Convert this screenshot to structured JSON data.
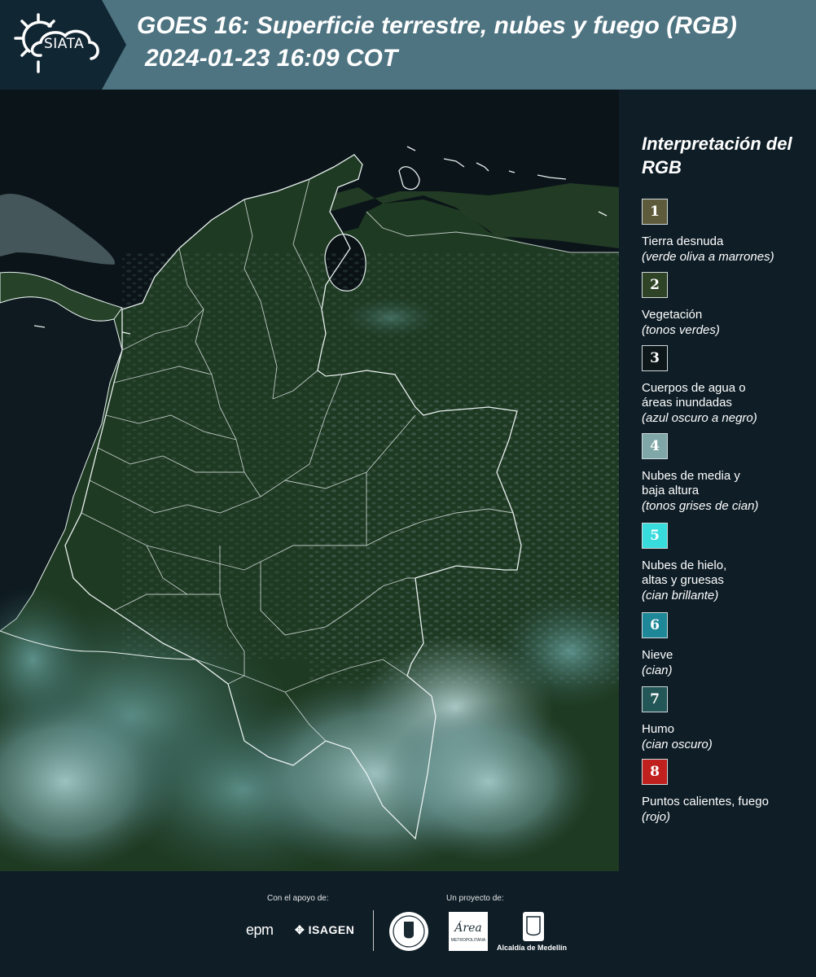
{
  "header": {
    "logo_text": "SIATA",
    "title": "GOES 16: Superficie terrestre, nubes y fuego (RGB)",
    "datetime": " 2024-01-23 16:09 COT"
  },
  "legend": {
    "title": "Interpretación del RGB",
    "items": [
      {
        "number": "1",
        "color": "#5e5b3d",
        "label": "Tierra desnuda",
        "description": "(verde oliva a marrones)"
      },
      {
        "number": "2",
        "color": "#2f4326",
        "label": "Vegetación",
        "description": "(tonos verdes)"
      },
      {
        "number": "3",
        "color": "#0d1618",
        "label": "Cuerpos de agua o\náreas inundadas",
        "description": "(azul oscuro a negro)"
      },
      {
        "number": "4",
        "color": "#7fa7a7",
        "label": "Nubes de media y\nbaja altura",
        "description": "(tonos grises de cian)"
      },
      {
        "number": "5",
        "color": "#38dcdc",
        "label": "Nubes de hielo,\naltas y gruesas",
        "description": "(cian brillante)"
      },
      {
        "number": "6",
        "color": "#1e8898",
        "label": "Nieve",
        "description": "(cian)"
      },
      {
        "number": "7",
        "color": "#235656",
        "label": "Humo",
        "description": "(cian oscuro)"
      },
      {
        "number": "8",
        "color": "#c0201e",
        "label": "Puntos calientes, fuego",
        "description": "(rojo)"
      }
    ]
  },
  "footer": {
    "support_label": "Con el apoyo de:",
    "project_label": "Un proyecto de:",
    "epm": "epm",
    "isagen": "ISAGEN",
    "area_logo": "Área",
    "area_sub": "METROPOLITANA",
    "alcaldia": "Alcaldía de Medellín"
  }
}
